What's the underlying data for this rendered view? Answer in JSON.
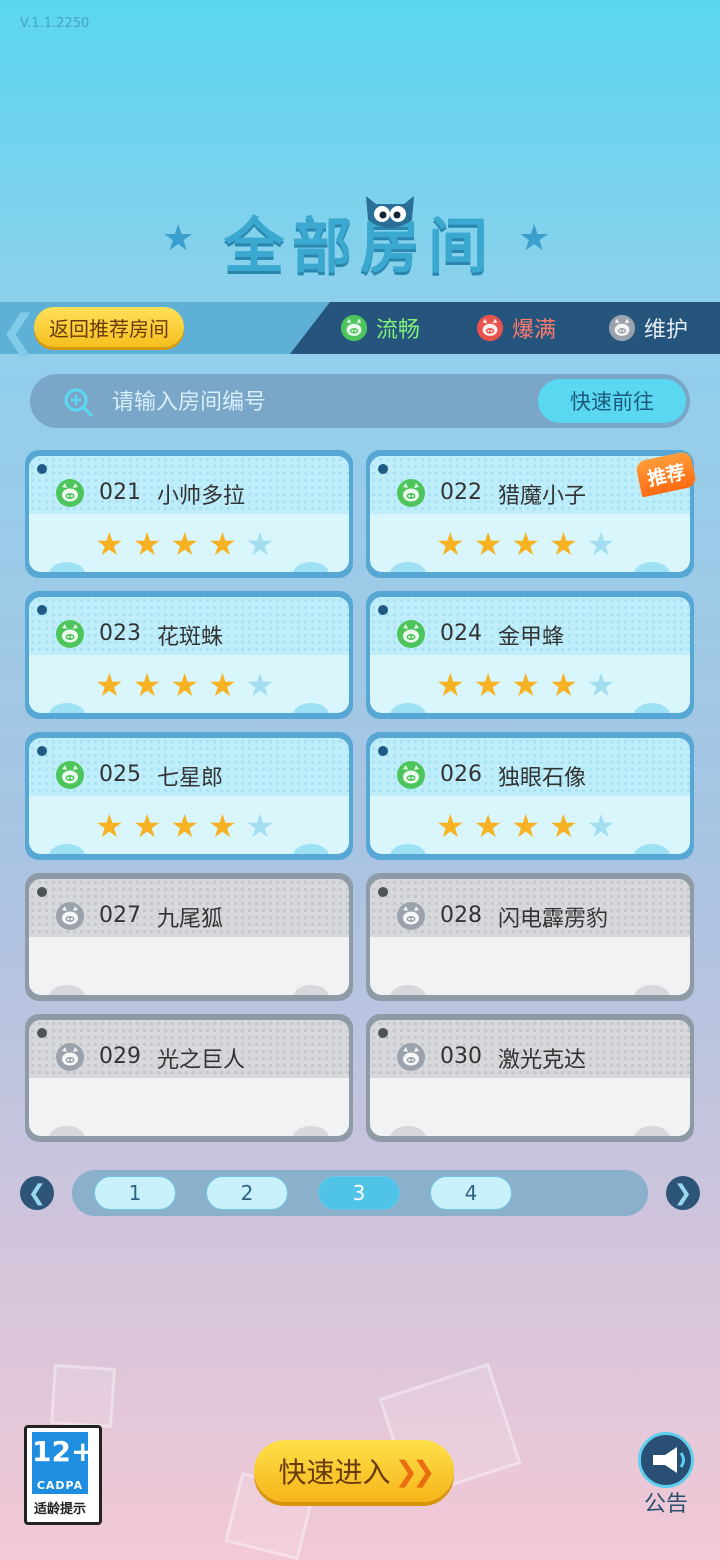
{
  "version": "V.1.1.2250",
  "title": "全部房间",
  "header": {
    "back_label": "返回推荐房间",
    "legend": [
      {
        "label": "流畅",
        "color": "#4cc55a"
      },
      {
        "label": "爆满",
        "color": "#e8524c"
      },
      {
        "label": "维护",
        "color": "#9aa3ab"
      }
    ]
  },
  "search": {
    "placeholder": "请输入房间编号",
    "go_label": "快速前往"
  },
  "rooms": [
    {
      "num": "021",
      "name": "小帅多拉",
      "status": "流畅",
      "rating": 4,
      "max": 5,
      "recommended": false
    },
    {
      "num": "022",
      "name": "猎魔小子",
      "status": "流畅",
      "rating": 4,
      "max": 5,
      "recommended": true
    },
    {
      "num": "023",
      "name": "花斑蛛",
      "status": "流畅",
      "rating": 4,
      "max": 5,
      "recommended": false
    },
    {
      "num": "024",
      "name": "金甲蜂",
      "status": "流畅",
      "rating": 4,
      "max": 5,
      "recommended": false
    },
    {
      "num": "025",
      "name": "七星郎",
      "status": "流畅",
      "rating": 4,
      "max": 5,
      "recommended": false
    },
    {
      "num": "026",
      "name": "独眼石像",
      "status": "流畅",
      "rating": 4,
      "max": 5,
      "recommended": false
    },
    {
      "num": "027",
      "name": "九尾狐",
      "status": "维护"
    },
    {
      "num": "028",
      "name": "闪电霹雳豹",
      "status": "维护"
    },
    {
      "num": "029",
      "name": "光之巨人",
      "status": "维护"
    },
    {
      "num": "030",
      "name": "激光克达",
      "status": "维护"
    }
  ],
  "recommend_badge": "推荐",
  "pagination": {
    "pages": [
      "1",
      "2",
      "3",
      "4"
    ],
    "current": "3"
  },
  "age_rating": {
    "age": "12+",
    "org": "CADPA",
    "label": "适龄提示"
  },
  "quick_enter_label": "快速进入",
  "notice_label": "公告"
}
